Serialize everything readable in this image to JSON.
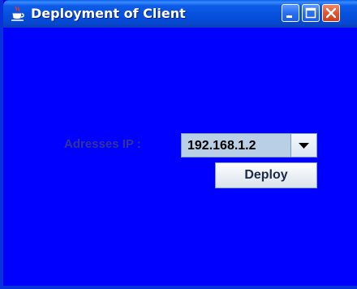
{
  "window": {
    "title": "Deployment of Client",
    "icon": "java-cup-icon"
  },
  "titlebar_buttons": {
    "minimize": "minimize-icon",
    "maximize": "maximize-icon",
    "close": "close-icon"
  },
  "form": {
    "ip_label": "Adresses IP :",
    "ip_selected": "192.168.1.2",
    "deploy_label": "Deploy"
  },
  "colors": {
    "content_background": "#0000ff",
    "titlebar": "#0550dd",
    "label_text": "#333399"
  }
}
